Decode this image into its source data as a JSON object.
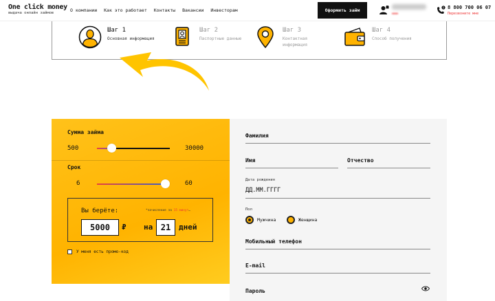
{
  "header": {
    "logo_title": "One click money",
    "logo_subtitle": "выдача онлайн займов",
    "nav": [
      "О компании",
      "Как это работает",
      "Контакты",
      "Вакансии",
      "Инвесторам"
    ],
    "cta_label": "Оформить займ",
    "phone": "8 800 700 06 07",
    "callback_label": "Перезвоните мне"
  },
  "steps": [
    {
      "title": "Шаг 1",
      "desc_1": "Основная информация",
      "desc_2": "",
      "icon": "user-icon",
      "active": true
    },
    {
      "title": "Шаг 2",
      "desc_1": "Паспортные данные",
      "desc_2": "",
      "icon": "passport-icon",
      "active": false
    },
    {
      "title": "Шаг 3",
      "desc_1": "Контактная",
      "desc_2": "информация",
      "icon": "location-pin-icon",
      "active": false
    },
    {
      "title": "Шаг 4",
      "desc_1": "Способ получения",
      "desc_2": "",
      "icon": "wallet-icon",
      "active": false
    }
  ],
  "calculator": {
    "amount_label": "Сумма займа",
    "amount_min": "500",
    "amount_max": "30000",
    "amount_fraction": 0.16,
    "term_label": "Срок",
    "term_min": "6",
    "term_max": "60",
    "term_fraction": 1.0,
    "take_label": "Вы берёте:",
    "note_prefix": "*зачисление за ",
    "note_highlight": "15 минут",
    "note_suffix": "…",
    "amount_value": "5000",
    "currency": "₽",
    "on_label": "на",
    "days_value": "21",
    "days_label": "дней",
    "promo_label": "У меня есть промо-код"
  },
  "form": {
    "surname_label": "Фамилия",
    "name_label": "Имя",
    "patronymic_label": "Отчество",
    "birth_label": "Дата рождения",
    "birth_placeholder": "ДД.ММ.ГГГГ",
    "gender_label": "Пол",
    "gender_male": "Мужчина",
    "gender_female": "Женщина",
    "phone_label": "Мобильный телефон",
    "email_label": "E-mail",
    "password_label": "Пароль"
  },
  "colors": {
    "accent": "#ffb300",
    "dark": "#111111",
    "slider_red": "#e8413c",
    "slider_blue": "#3a5fc8"
  }
}
